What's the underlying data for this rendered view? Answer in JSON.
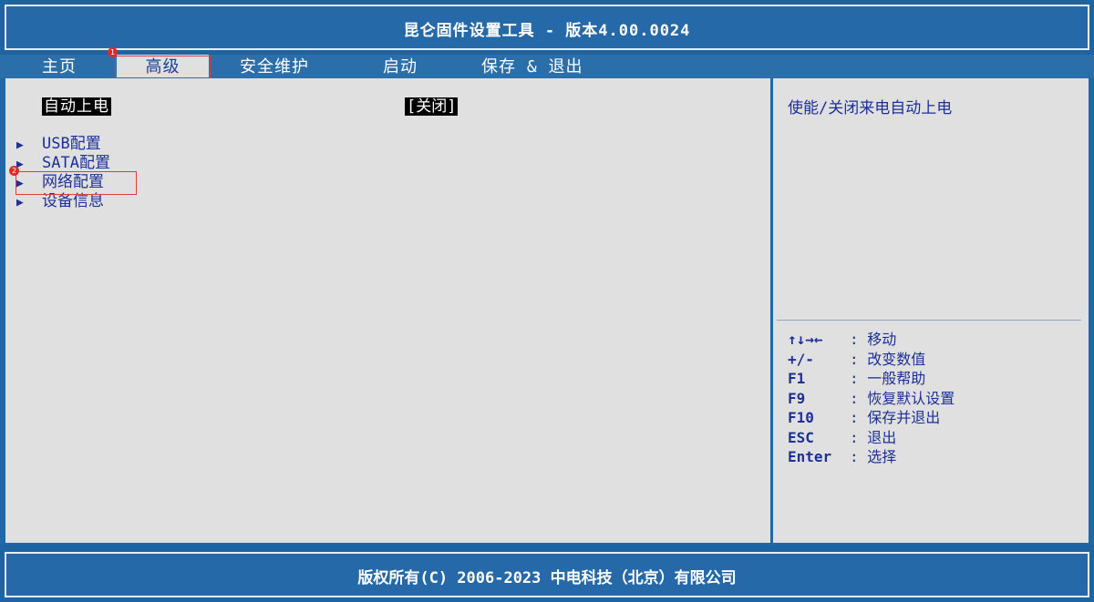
{
  "window": {
    "title": "昆仑固件设置工具 - 版本4.00.0024"
  },
  "tabs": [
    {
      "label": "主页",
      "active": false
    },
    {
      "label": "高级",
      "active": true
    },
    {
      "label": "安全维护",
      "active": false
    },
    {
      "label": "启动",
      "active": false
    },
    {
      "label": "保存 & 退出",
      "active": false
    }
  ],
  "annotations": {
    "badge1": "1",
    "badge2": "2",
    "highlight_color": "#e23b3b"
  },
  "settings": {
    "auto_power_on": {
      "label": "自动上电",
      "value": "[关闭]"
    }
  },
  "menu": [
    {
      "label": "USB配置",
      "icon": "triangle-right-icon"
    },
    {
      "label": "SATA配置",
      "icon": "triangle-right-icon"
    },
    {
      "label": "网络配置",
      "icon": "triangle-right-icon"
    },
    {
      "label": "设备信息",
      "icon": "triangle-right-icon"
    }
  ],
  "help": {
    "description": "使能/关闭来电自动上电",
    "keys": [
      {
        "key": "↑↓→←",
        "desc": ": 移动"
      },
      {
        "key": "+/-",
        "desc": ": 改变数值"
      },
      {
        "key": "F1",
        "desc": ": 一般帮助"
      },
      {
        "key": "F9",
        "desc": ": 恢复默认设置"
      },
      {
        "key": "F10",
        "desc": ": 保存并退出"
      },
      {
        "key": "ESC",
        "desc": ": 退出"
      },
      {
        "key": "Enter",
        "desc": ": 选择"
      }
    ]
  },
  "footer": {
    "copyright": "版权所有(C) 2006-2023 中电科技（北京）有限公司"
  },
  "colors": {
    "bar_blue": "#2669a8",
    "panel_gray": "#e0e0e0",
    "text_blue": "#1c2f9a"
  }
}
